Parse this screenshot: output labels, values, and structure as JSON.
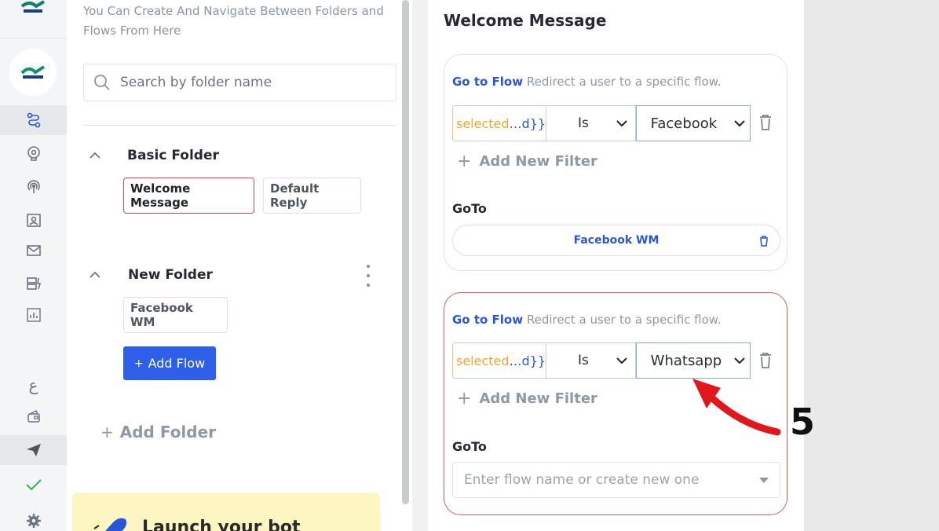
{
  "sidebar": {
    "items": [
      {
        "name": "flows-icon",
        "active": true
      },
      {
        "name": "bot-settings-icon"
      },
      {
        "name": "broadcast-icon"
      },
      {
        "name": "contacts-icon"
      },
      {
        "name": "inbox-icon"
      },
      {
        "name": "templates-icon"
      },
      {
        "name": "analytics-icon"
      }
    ],
    "bottom_items": [
      {
        "name": "language-icon",
        "glyph": "ع"
      },
      {
        "name": "wallet-icon"
      },
      {
        "name": "send-icon"
      },
      {
        "name": "check-icon"
      },
      {
        "name": "gear-icon"
      }
    ]
  },
  "folders_panel": {
    "description": "You Can Create And Navigate Between Folders and Flows From Here",
    "search_placeholder": "Search by folder name",
    "folders": [
      {
        "name": "Basic Folder",
        "flows": [
          "Welcome Message",
          "Default Reply"
        ],
        "selected_flow": "Welcome Message"
      },
      {
        "name": "New Folder",
        "flows": [
          "Facebook WM"
        ]
      }
    ],
    "add_flow_label": "Add Flow",
    "add_flow_prefix": "+",
    "add_folder_label": "Add Folder",
    "add_folder_prefix": "+",
    "launch_banner_text": "Launch your bot"
  },
  "editor": {
    "title": "Welcome Message",
    "cards": [
      {
        "action_label": "Go to Flow",
        "action_desc": "Redirect a user to a specific flow.",
        "filter": {
          "variable_prefix": "selected",
          "variable_ellipsis": "…",
          "variable_suffix": "d}}",
          "operator": "Is",
          "value": "Facebook"
        },
        "add_filter_label": "Add New Filter",
        "goto_label": "GoTo",
        "goto_value": "Facebook WM"
      },
      {
        "action_label": "Go to Flow",
        "action_desc": "Redirect a user to a specific flow.",
        "filter": {
          "variable_prefix": "selected",
          "variable_ellipsis": "…",
          "variable_suffix": "d}}",
          "operator": "Is",
          "value": "Whatsapp"
        },
        "add_filter_label": "Add New Filter",
        "goto_label": "GoTo",
        "goto_placeholder": "Enter flow name or create new one"
      }
    ]
  },
  "annotation": {
    "step_number": "5",
    "color": "#e3161e"
  },
  "colors": {
    "primary": "#2f5ee8",
    "selected_border": "#e0453f",
    "variable_orange": "#f0a52a"
  }
}
